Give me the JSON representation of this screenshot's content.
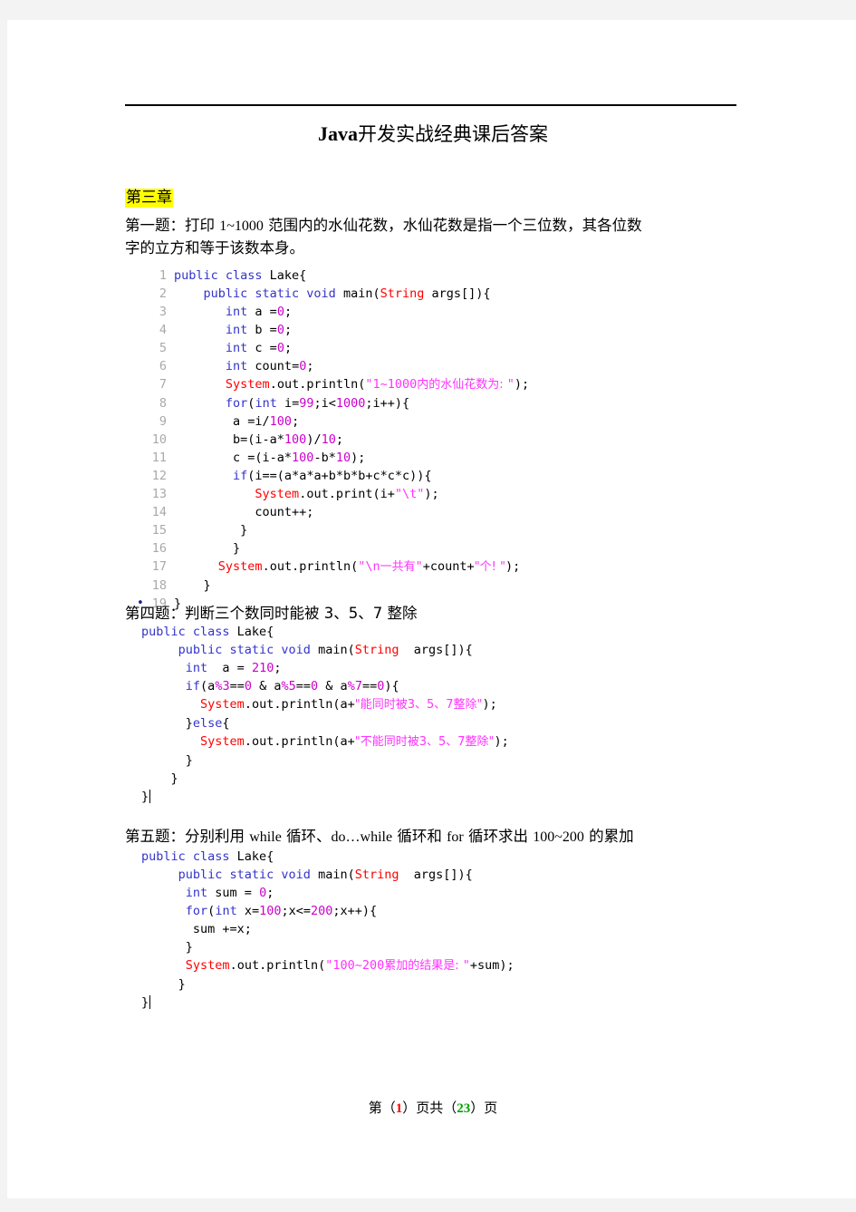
{
  "document": {
    "title_latin": "Java",
    "title_han": "开发实战经典课后答案",
    "chapter_label": "第三章"
  },
  "footer": {
    "prefix": "第（",
    "page": "1",
    "middle": "）页共（",
    "total": "23",
    "suffix": "）页"
  },
  "sections": [
    {
      "heading_han_a": "第一题：打印 ",
      "heading_lat_a": "1~1000",
      "heading_han_b": " 范围内的水仙花数，水仙花数是指一个三位数，其各位数",
      "heading_line2": "字的立方和等于该数本身。"
    },
    {
      "heading": "第四题：判断三个数同时能被 3、5、7 整除"
    },
    {
      "heading_han_a": "第五题：分别利用 ",
      "heading_lat_a": "while",
      "heading_han_b": " 循环、",
      "heading_lat_b": "do…while",
      "heading_han_c": " 循环和 ",
      "heading_lat_c": "for",
      "heading_han_d": " 循环求出 ",
      "heading_lat_d": "100~200",
      "heading_han_e": " 的累加"
    }
  ],
  "code_blocks": [
    {
      "name": "narcissistic-number-code",
      "numbered": true,
      "lines": [
        "public class Lake{",
        "    public static void main(String args[]){",
        "       int a =0;",
        "       int b =0;",
        "       int c =0;",
        "       int count=0;",
        "       System.out.println(\"1~1000内的水仙花数为: \");",
        "       for(int i=99;i<1000;i++){",
        "        a =i/100;",
        "        b=(i-a*100)/10;",
        "        c =(i-a*100-b*10);",
        "        if(i==(a*a*a+b*b*b+c*c*c)){",
        "           System.out.print(i+\"\\t\");",
        "           count++;",
        "         }",
        "        }",
        "      System.out.println(\"\\n一共有\"+count+\"个! \");",
        "    }",
        "}"
      ]
    },
    {
      "name": "divisible-by-3-5-7-code",
      "numbered": false,
      "lines": [
        "public class Lake{",
        "     public static void main(String  args[]){",
        "      int  a = 210;",
        "      if(a%3==0 & a%5==0 & a%7==0){",
        "        System.out.println(a+\"能同时被3、5、7整除\");",
        "      }else{",
        "        System.out.println(a+\"不能同时被3、5、7整除\");",
        "      }",
        "    }",
        "}"
      ]
    },
    {
      "name": "sum-100-to-200-code",
      "numbered": false,
      "lines": [
        "public class Lake{",
        "     public static void main(String  args[]){",
        "      int sum = 0;",
        "      for(int x=100;x<=200;x++){",
        "       sum +=x;",
        "      }",
        "      System.out.println(\"100~200累加的结果是: \"+sum);",
        "     }",
        "}"
      ]
    }
  ]
}
